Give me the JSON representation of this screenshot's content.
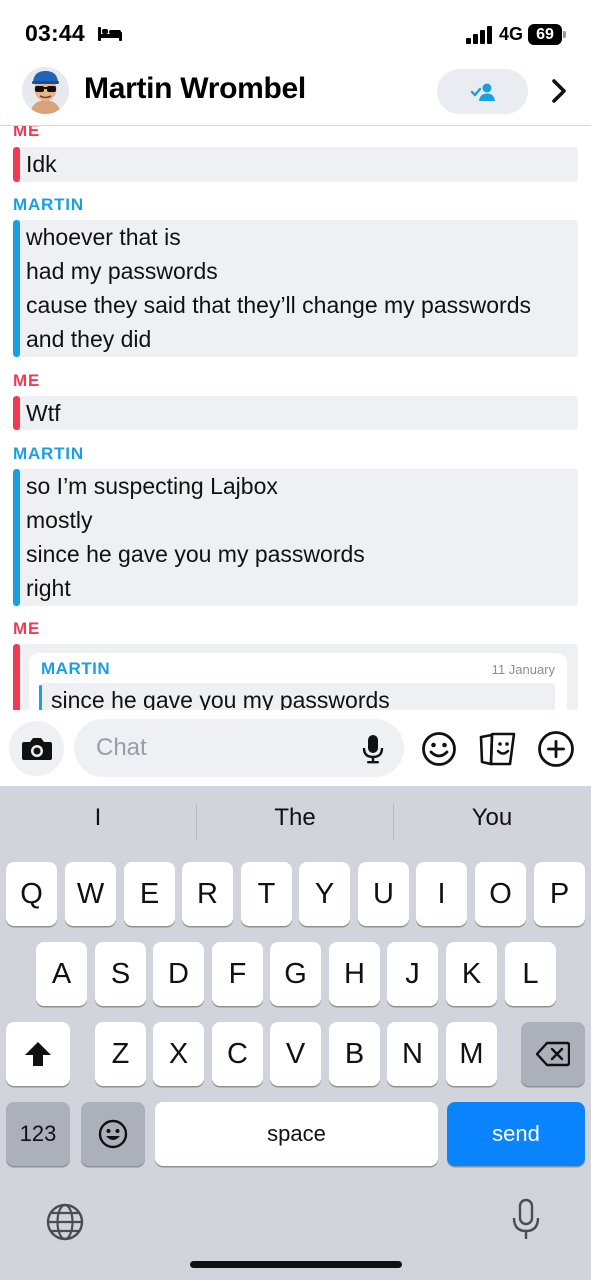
{
  "status": {
    "time": "03:44",
    "network": "4G",
    "battery": "69"
  },
  "header": {
    "contact_name": "Martin Wrombel"
  },
  "messages": [
    {
      "sender": "ME",
      "lines": [
        "Idk"
      ]
    },
    {
      "sender": "MARTIN",
      "lines": [
        "whoever that is",
        "had my passwords",
        "cause they said that they’ll change my passwords",
        "and they did"
      ]
    },
    {
      "sender": "ME",
      "lines": [
        "Wtf"
      ]
    },
    {
      "sender": "MARTIN",
      "lines": [
        "so I’m suspecting Lajbox",
        "mostly",
        "since he gave you my passwords",
        "right"
      ]
    },
    {
      "sender": "ME",
      "quote": {
        "sender": "MARTIN",
        "date": "11 January",
        "text": "since he gave you my passwords"
      }
    }
  ],
  "input": {
    "placeholder": "Chat"
  },
  "keyboard": {
    "suggestions": [
      "I",
      "The",
      "You"
    ],
    "row1": [
      "Q",
      "W",
      "E",
      "R",
      "T",
      "Y",
      "U",
      "I",
      "O",
      "P"
    ],
    "row2": [
      "A",
      "S",
      "D",
      "F",
      "G",
      "H",
      "J",
      "K",
      "L"
    ],
    "row3": [
      "Z",
      "X",
      "C",
      "V",
      "B",
      "N",
      "M"
    ],
    "numbers_label": "123",
    "space_label": "space",
    "send_label": "send"
  },
  "colors": {
    "me": "#ee3b53",
    "martin": "#1aa0e0",
    "send": "#0a84ff"
  },
  "icons": [
    "bed-icon",
    "signal-icon",
    "battery-icon",
    "avatar",
    "add-friend-icon",
    "chevron-right-icon",
    "camera-icon",
    "mic-icon",
    "emoji-icon",
    "sticker-icon",
    "plus-icon",
    "shift-icon",
    "backspace-icon",
    "emoji-keyboard-icon",
    "globe-icon",
    "dictation-mic-icon"
  ]
}
